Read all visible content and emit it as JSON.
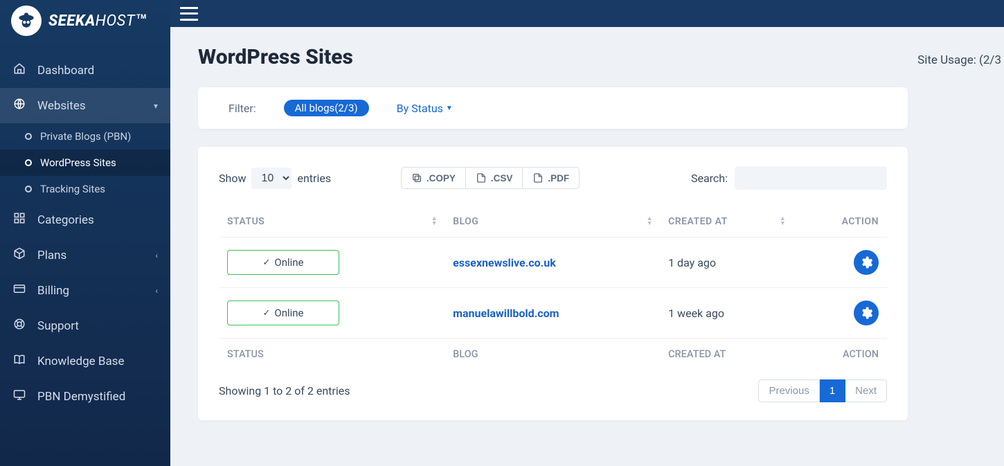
{
  "brand": {
    "name_bold": "SEEKA",
    "name_thin": "HOST",
    "tm": "TM"
  },
  "sidebar": {
    "items": [
      {
        "label": "Dashboard"
      },
      {
        "label": "Websites"
      },
      {
        "label": "Categories"
      },
      {
        "label": "Plans"
      },
      {
        "label": "Billing"
      },
      {
        "label": "Support"
      },
      {
        "label": "Knowledge Base"
      },
      {
        "label": "PBN Demystified"
      }
    ],
    "websites_sub": [
      {
        "label": "Private Blogs (PBN)"
      },
      {
        "label": "WordPress Sites"
      },
      {
        "label": "Tracking Sites"
      }
    ]
  },
  "page": {
    "title": "WordPress Sites",
    "usage_label": "Site Usage: (2/3"
  },
  "filter": {
    "label": "Filter:",
    "all_pill": "All blogs(2/3)",
    "by_status": "By Status"
  },
  "table": {
    "show_label": "Show",
    "entries_word": "entries",
    "entries_value": "10",
    "export": {
      "copy": ".COPY",
      "csv": ".CSV",
      "pdf": ".PDF"
    },
    "search_label": "Search:",
    "search_value": "",
    "columns": {
      "status": "STATUS",
      "blog": "BLOG",
      "created": "CREATED AT",
      "action": "ACTION"
    },
    "rows": [
      {
        "status": "Online",
        "blog": "essexnewslive.co.uk",
        "created": "1 day ago"
      },
      {
        "status": "Online",
        "blog": "manuelawillbold.com",
        "created": "1 week ago"
      }
    ],
    "footer": {
      "status": "STATUS",
      "blog": "BLOG",
      "created": "CREATED AT",
      "action": "ACTION"
    },
    "showing": "Showing 1 to 2 of 2 entries",
    "pager": {
      "prev": "Previous",
      "page": "1",
      "next": "Next"
    }
  }
}
